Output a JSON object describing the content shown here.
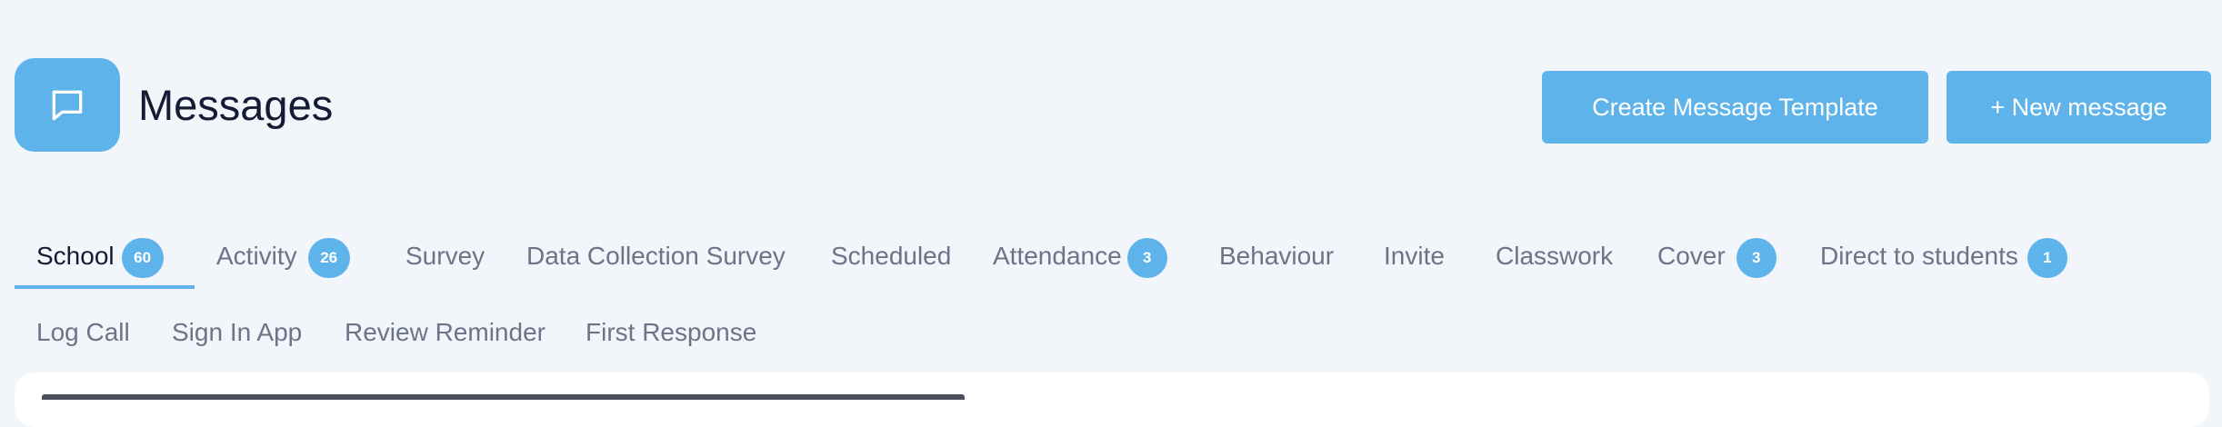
{
  "header": {
    "title": "Messages",
    "icon": "chat-bubble-icon",
    "create_template_label": "Create Message Template",
    "new_message_label": "+ New message"
  },
  "tabs": [
    {
      "label": "School",
      "badge": "60",
      "active": true
    },
    {
      "label": "Activity",
      "badge": "26"
    },
    {
      "label": "Survey"
    },
    {
      "label": "Data Collection Survey"
    },
    {
      "label": "Scheduled"
    },
    {
      "label": "Attendance",
      "badge": "3"
    },
    {
      "label": "Behaviour"
    },
    {
      "label": "Invite"
    },
    {
      "label": "Classwork"
    },
    {
      "label": "Cover",
      "badge": "3"
    },
    {
      "label": "Direct to students",
      "badge": "1"
    },
    {
      "label": "Log Call"
    },
    {
      "label": "Sign In App"
    },
    {
      "label": "Review Reminder"
    },
    {
      "label": "First Response"
    }
  ],
  "colors": {
    "accent": "#5eb3ea",
    "background": "#f2f5f9",
    "title_text": "#141b34",
    "tab_text": "#6b7488"
  }
}
